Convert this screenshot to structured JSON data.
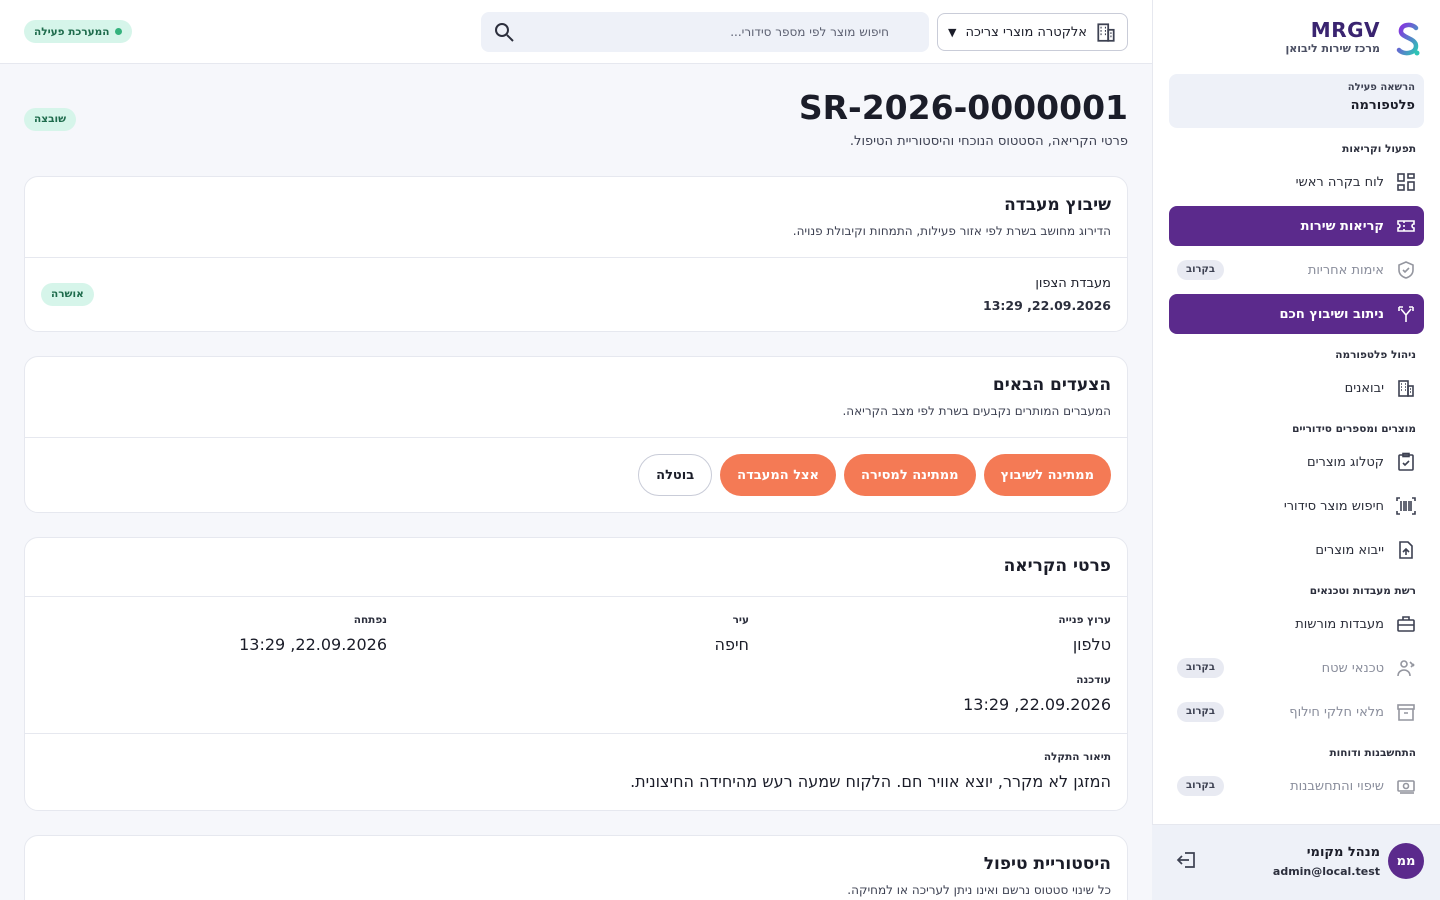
{
  "sidebar": {
    "brand_name": "MRGV",
    "brand_sub": "מרכז שירות ליבואן",
    "permission_label": "הרשאה פעילה",
    "permission_value": "פלטפורמה",
    "sections": {
      "ops": "תפעול וקריאות",
      "platform": "ניהול פלטפורמה",
      "products": "מוצרים ומספרים סידוריים",
      "labs": "רשת מעבדות וטכנאים",
      "billing": "התחשבנות ודוחות"
    },
    "items": {
      "dashboard": "לוח בקרה ראשי",
      "service_calls": "קריאות שירות",
      "warranty": "אימות אחריות",
      "routing": "ניתוב ושיבוץ חכם",
      "importers": "יבואנים",
      "catalog": "קטלוג מוצרים",
      "serial_search": "חיפוש מוצר סידורי",
      "import_products": "ייבוא מוצרים",
      "labs": "מעבדות מורשות",
      "technicians": "טכנאי שטח",
      "spare_parts": "מלאי חלקי חילוף",
      "billing": "שיפוי והתחשבנות"
    },
    "soon_label": "בקרוב",
    "user_initials": "ממ",
    "user_name": "מנהל מקומי",
    "user_email": "admin@local.test"
  },
  "topbar": {
    "org_selector": "אלקטרה מוצרי צריכה",
    "search_placeholder": "חיפוש מוצר לפי מספר סידורי...",
    "system_status": "המערכת פעילה"
  },
  "page": {
    "title": "SR-2026-0000001",
    "subtitle": "פרטי הקריאה, הסטטוס הנוכחי והיסטוריית הטיפול.",
    "status_badge": "שובצה"
  },
  "lab_assignment": {
    "title": "שיבוץ מעבדה",
    "subtitle": "הדירוג מחושב בשרת לפי אזור פעילות, התמחות וקיבולת פנויה.",
    "lab_name": "מעבדת הצפון",
    "lab_date": "22.09.2026, 13:29",
    "lab_status": "אושרה"
  },
  "next_steps": {
    "title": "הצעדים הבאים",
    "subtitle": "המעברים המותרים נקבעים בשרת לפי מצב הקריאה.",
    "actions": [
      "ממתינה לשיבוץ",
      "ממתינה למסירה",
      "אצל המעבדה",
      "בוטלה"
    ]
  },
  "call_details": {
    "title": "פרטי הקריאה",
    "channel_label": "ערוץ פנייה",
    "channel_value": "טלפון",
    "city_label": "עיר",
    "city_value": "חיפה",
    "opened_label": "נפתחה",
    "opened_value": "22.09.2026, 13:29",
    "updated_label": "עודכנה",
    "updated_value": "22.09.2026, 13:29",
    "fault_label": "תיאור התקלה",
    "fault_value": "המזגן לא מקרר, יוצא אוויר חם. הלקוח שמעה רעש מהיחידה החיצונית."
  },
  "history": {
    "title": "היסטוריית טיפול",
    "subtitle": "כל שינוי סטטוס נרשם ואינו ניתן לעריכה או למחיקה."
  }
}
